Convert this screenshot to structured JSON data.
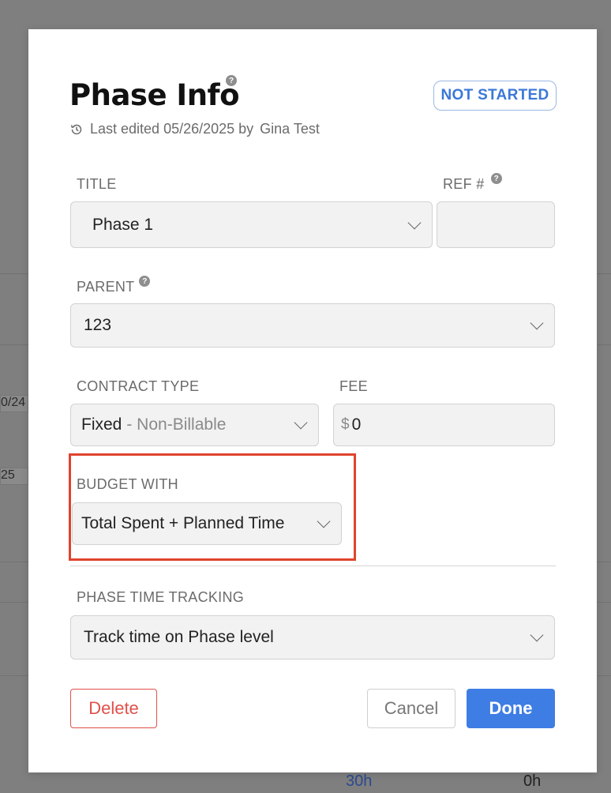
{
  "background": {
    "row_fragment_1": "0/24",
    "row_fragment_2": "25",
    "hours_a": "30h",
    "hours_b": "0h"
  },
  "modal": {
    "title": "Phase Info",
    "help_glyph": "?",
    "status": "NOT STARTED",
    "last_edited_prefix": "Last edited 05/26/2025 by",
    "last_edited_user": "Gina Test"
  },
  "form": {
    "title_label": "TITLE",
    "title_value": "Phase 1",
    "ref_label": "REF #",
    "ref_value": "",
    "parent_label": "PARENT",
    "parent_value": "123",
    "contract_type_label": "CONTRACT TYPE",
    "contract_type_value": "Fixed",
    "contract_type_sub": "- Non-Billable",
    "fee_label": "FEE",
    "fee_currency": "$",
    "fee_value": "0",
    "budget_with_label": "BUDGET WITH",
    "budget_with_value": "Total Spent + Planned Time",
    "phase_time_tracking_label": "PHASE TIME TRACKING",
    "phase_time_tracking_value": "Track time on Phase level"
  },
  "actions": {
    "delete": "Delete",
    "cancel": "Cancel",
    "done": "Done"
  },
  "colors": {
    "primary": "#3e7de4",
    "danger": "#e0514a",
    "highlight": "#e0442e",
    "overlay": "#7f7f7f"
  }
}
